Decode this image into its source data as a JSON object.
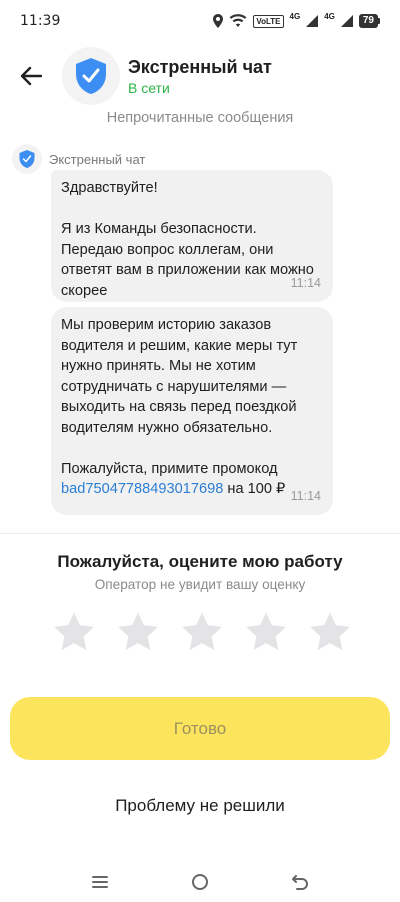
{
  "status_bar": {
    "time": "11:39",
    "volte": "VoLTE",
    "network_1": "4G",
    "network_2": "4G",
    "battery": "79"
  },
  "header": {
    "title": "Экстренный чат",
    "status": "В сети",
    "status_color": "#2eb548",
    "avatar_icon": "shield-check-icon"
  },
  "chat": {
    "unread_divider": "Непрочитанные сообщения",
    "sender_name": "Экстренный чат",
    "messages": [
      {
        "text": "Здравствуйте!\n\nЯ из Команды безопасности. Передаю вопрос коллегам, они ответят вам в приложении как можно скорее",
        "time": "11:14"
      },
      {
        "text": "Мы проверим историю заказов водителя и решим, какие меры тут нужно принять. Мы не хотим сотрудничать с нарушителями — выходить на связь перед поездкой водителям нужно обязательно.\n\nПожалуйста, примите промокод ",
        "promo_code": "bad75047788493017698",
        "text_after": " на 100 ₽",
        "time": "11:14"
      }
    ]
  },
  "rating": {
    "title": "Пожалуйста, оцените мою работу",
    "subtitle": "Оператор не увидит вашу оценку",
    "stars_total": 5,
    "stars_selected": 0
  },
  "actions": {
    "done_label": "Готово",
    "not_solved_label": "Проблему не решили"
  },
  "colors": {
    "accent_yellow": "#fce45c",
    "link_blue": "#2b7fd4",
    "shield_blue": "#3d8ef2"
  }
}
